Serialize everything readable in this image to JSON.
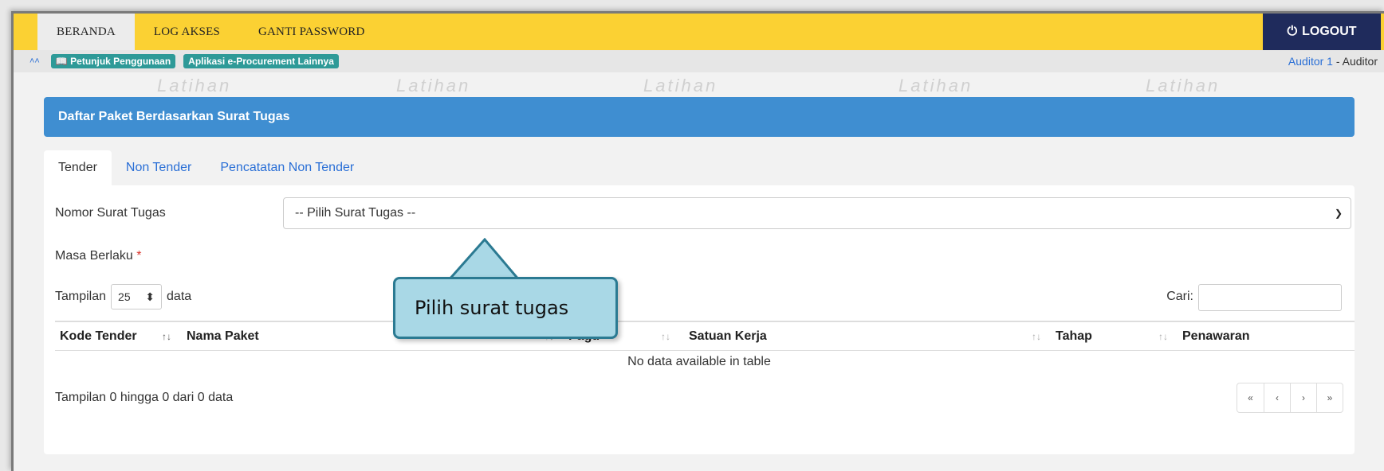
{
  "topnav": {
    "items": [
      {
        "label": "BERANDA",
        "active": true
      },
      {
        "label": "LOG AKSES",
        "active": false
      },
      {
        "label": "GANTI PASSWORD",
        "active": false
      }
    ],
    "logout_label": "LOGOUT"
  },
  "infobar": {
    "guide_label": "Petunjuk Penggunaan",
    "other_apps_label": "Aplikasi e-Procurement Lainnya",
    "user_name": "Auditor 1",
    "user_role": " - Auditor"
  },
  "watermark_text": "Latihan",
  "panel": {
    "title": "Daftar Paket Berdasarkan Surat Tugas"
  },
  "tabs": [
    {
      "label": "Tender",
      "active": true
    },
    {
      "label": "Non Tender",
      "active": false
    },
    {
      "label": "Pencatatan Non Tender",
      "active": false
    }
  ],
  "form": {
    "surat_tugas_label": "Nomor Surat Tugas",
    "surat_tugas_value": "-- Pilih Surat Tugas --",
    "masa_berlaku_label": "Masa Berlaku",
    "required_mark": "*"
  },
  "table_controls": {
    "show_prefix": "Tampilan",
    "page_size": "25",
    "show_suffix": "data",
    "search_label": "Cari:"
  },
  "table": {
    "columns": [
      "Kode Tender",
      "Nama Paket",
      "Pagu",
      "Satuan Kerja",
      "Tahap",
      "Penawaran"
    ],
    "empty_text": "No data available in table",
    "info": "Tampilan 0 hingga 0 dari 0 data"
  },
  "pagination": [
    "«",
    "‹",
    "›",
    "»"
  ],
  "callout": {
    "text": "Pilih surat tugas"
  },
  "colors": {
    "nav_bg": "#fbd133",
    "logout_bg": "#1f2b5c",
    "panel_header": "#3f8ed1",
    "badge": "#2e9a98",
    "callout_bg": "#a9d8e6",
    "callout_border": "#2b7a92",
    "link": "#2a6fd6"
  }
}
